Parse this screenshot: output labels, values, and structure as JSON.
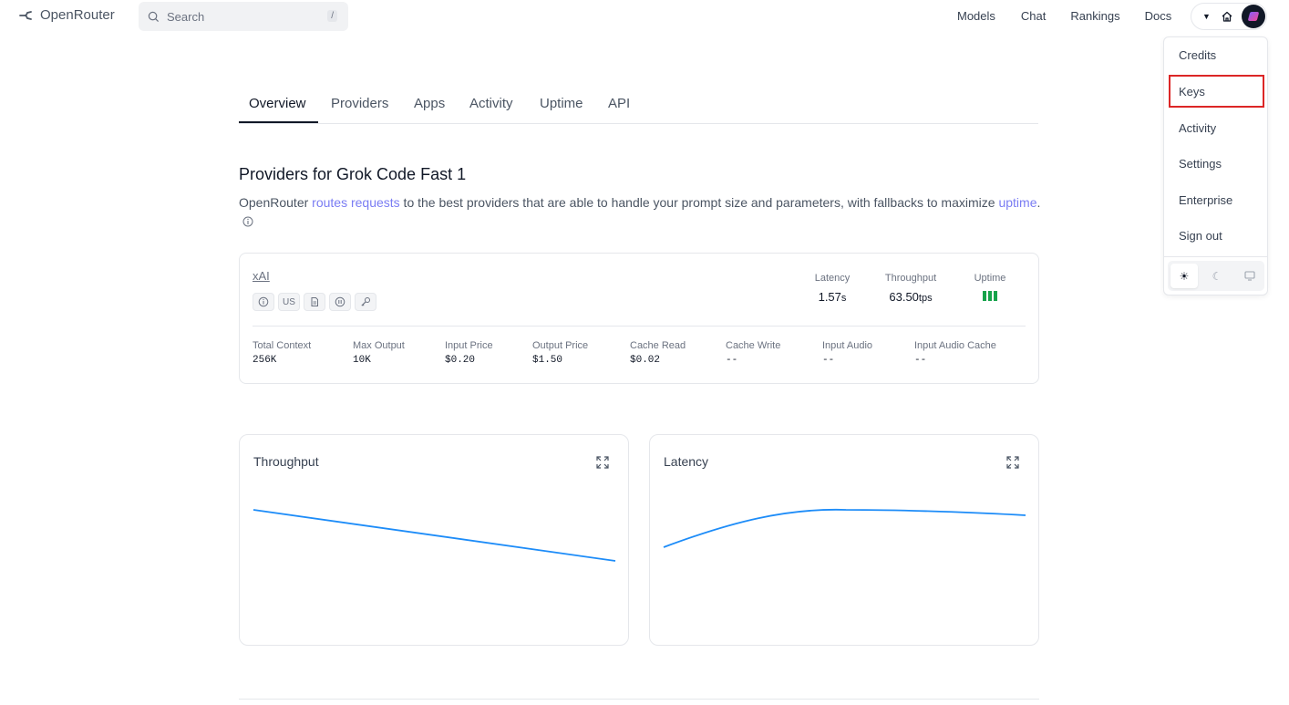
{
  "header": {
    "logo_text": "OpenRouter",
    "search_placeholder": "Search",
    "search_shortcut": "/",
    "nav": [
      "Models",
      "Chat",
      "Rankings",
      "Docs"
    ]
  },
  "account_menu": {
    "items": [
      "Credits",
      "Keys",
      "Activity",
      "Settings",
      "Enterprise",
      "Sign out"
    ],
    "highlighted": "Keys",
    "theme_options": [
      "light",
      "dark",
      "system"
    ],
    "theme_selected": "light",
    "highlight_color": "#dc2626"
  },
  "tabs": [
    "Overview",
    "Providers",
    "Apps",
    "Activity",
    "Uptime",
    "API"
  ],
  "active_tab": "Overview",
  "section": {
    "title": "Providers for Grok Code Fast 1",
    "desc_pre": "OpenRouter ",
    "desc_link": "routes requests",
    "desc_mid": " to the best providers that are able to handle your prompt size and parameters, with fallbacks to maximize ",
    "desc_link2": "uptime",
    "desc_end": "."
  },
  "provider": {
    "name": "xAI",
    "region_badge": "US",
    "stats": {
      "latency_label": "Latency",
      "latency_value": "1.57",
      "latency_unit": "s",
      "throughput_label": "Throughput",
      "throughput_value": "63.50",
      "throughput_unit": "tps",
      "uptime_label": "Uptime",
      "uptime_color": "#16a34a"
    },
    "specs": [
      {
        "label": "Total Context",
        "value": "256K"
      },
      {
        "label": "Max Output",
        "value": "10K"
      },
      {
        "label": "Input Price",
        "value": "$0.20"
      },
      {
        "label": "Output Price",
        "value": "$1.50"
      },
      {
        "label": "Cache Read",
        "value": "$0.02"
      },
      {
        "label": "Cache Write",
        "value": "--"
      },
      {
        "label": "Input Audio",
        "value": "--"
      },
      {
        "label": "Input Audio Cache",
        "value": "--"
      }
    ]
  },
  "charts": {
    "throughput_title": "Throughput",
    "latency_title": "Latency",
    "line_color": "#1d8cf8"
  }
}
